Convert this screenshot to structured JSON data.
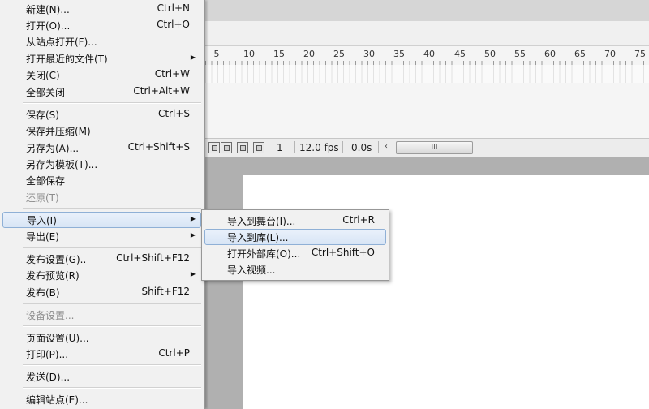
{
  "file_menu": {
    "items": [
      {
        "label": "新建(N)...",
        "shortcut": "Ctrl+N"
      },
      {
        "label": "打开(O)...",
        "shortcut": "Ctrl+O"
      },
      {
        "label": "从站点打开(F)..."
      },
      {
        "label": "打开最近的文件(T)",
        "submenu": true
      },
      {
        "label": "关闭(C)",
        "shortcut": "Ctrl+W"
      },
      {
        "label": "全部关闭",
        "shortcut": "Ctrl+Alt+W"
      },
      {
        "label": "保存(S)",
        "shortcut": "Ctrl+S"
      },
      {
        "label": "保存并压缩(M)"
      },
      {
        "label": "另存为(A)...",
        "shortcut": "Ctrl+Shift+S"
      },
      {
        "label": "另存为模板(T)..."
      },
      {
        "label": "全部保存"
      },
      {
        "label": "还原(T)",
        "disabled": true
      },
      {
        "label": "导入(I)",
        "submenu": true,
        "highlighted": true
      },
      {
        "label": "导出(E)",
        "submenu": true
      },
      {
        "label": "发布设置(G)..",
        "shortcut": "Ctrl+Shift+F12"
      },
      {
        "label": "发布预览(R)",
        "submenu": true
      },
      {
        "label": "发布(B)",
        "shortcut": "Shift+F12"
      },
      {
        "label": "设备设置...",
        "disabled": true
      },
      {
        "label": "页面设置(U)..."
      },
      {
        "label": "打印(P)...",
        "shortcut": "Ctrl+P"
      },
      {
        "label": "发送(D)..."
      },
      {
        "label": "编辑站点(E)..."
      }
    ]
  },
  "import_submenu": {
    "items": [
      {
        "label": "导入到舞台(I)...",
        "shortcut": "Ctrl+R"
      },
      {
        "label": "导入到库(L)...",
        "highlighted": true
      },
      {
        "label": "打开外部库(O)...",
        "shortcut": "Ctrl+Shift+O"
      },
      {
        "label": "导入视频..."
      }
    ]
  },
  "timeline": {
    "ruler_numbers": [
      "5",
      "10",
      "15",
      "20",
      "25",
      "30",
      "35",
      "40",
      "45",
      "50",
      "55",
      "60",
      "65",
      "70",
      "75"
    ],
    "current_frame": "1",
    "frame_rate": "12.0 fps",
    "elapsed_time": "0.0s",
    "scroll_arrow": "‹",
    "scroll_thumb_grip": "III"
  },
  "icons": {
    "submenu_arrow": "▶"
  }
}
